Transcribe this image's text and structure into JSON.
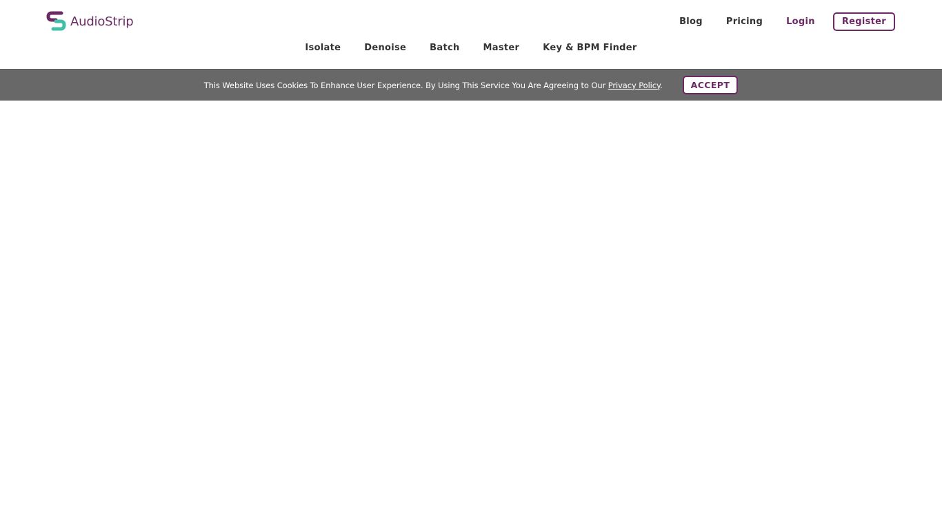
{
  "brand": {
    "name": "AudioStrip",
    "colors": {
      "primary": "#6b2a63",
      "accent": "#3fbfa8",
      "cookie_bar": "#686868"
    }
  },
  "top_nav": {
    "blog": "Blog",
    "pricing": "Pricing",
    "login": "Login",
    "register": "Register"
  },
  "tools_nav": [
    "Isolate",
    "Denoise",
    "Batch",
    "Master",
    "Key & BPM Finder"
  ],
  "cookie_banner": {
    "message": "This Website Uses Cookies To Enhance User Experience. By Using This Service You Are Agreeing to Our ",
    "link_text": "Privacy Policy",
    "suffix": ".",
    "accept_label": "ACCEPT"
  }
}
